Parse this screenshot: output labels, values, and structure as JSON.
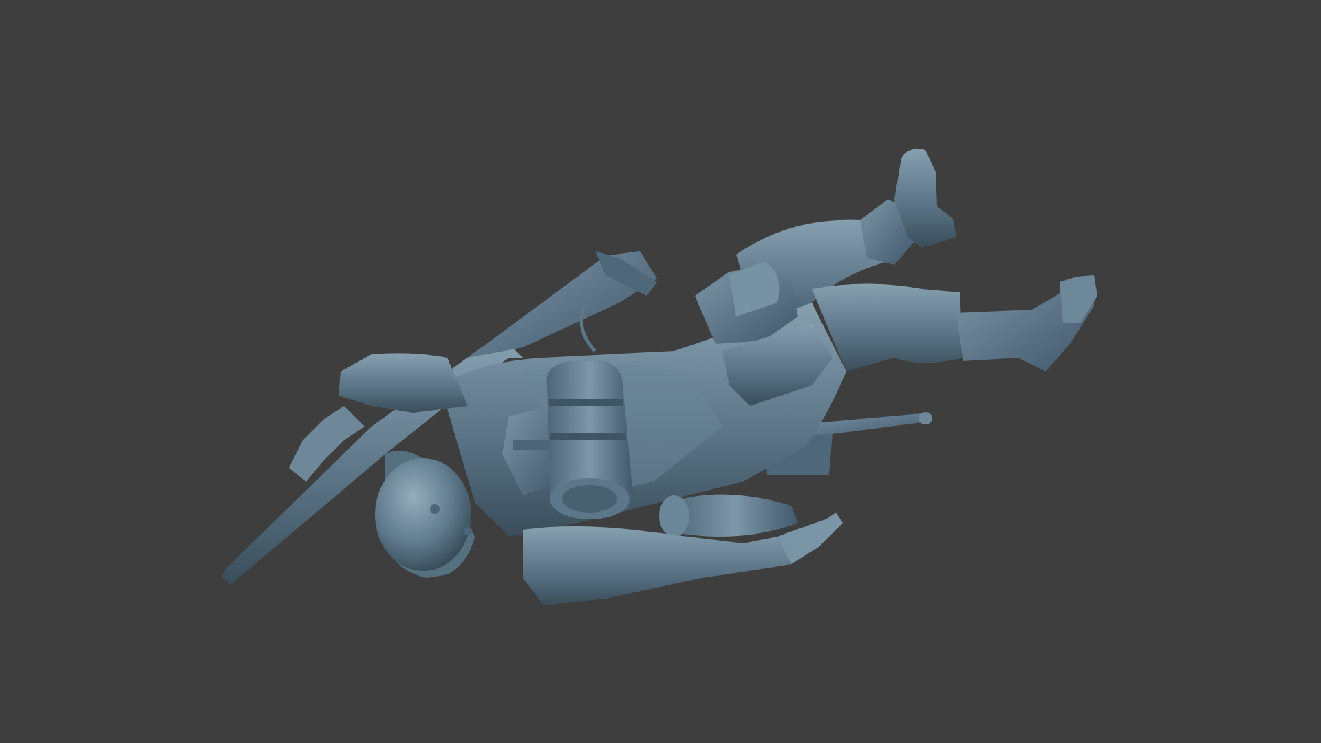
{
  "scene": {
    "background_color": "#3e3e3e",
    "model_color": "#5c7688",
    "model_highlight": "#86a0b0",
    "model_shadow": "#3a4d5a"
  }
}
